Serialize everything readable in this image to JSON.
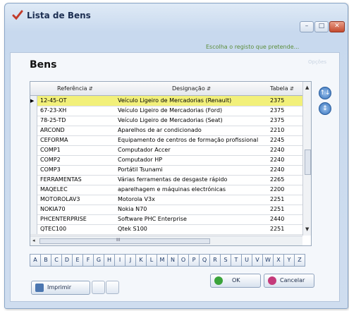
{
  "window": {
    "title": "Lista de Bens"
  },
  "controls": {
    "minimize": "–",
    "maximize": "□",
    "close": "✕"
  },
  "hint": "Escolha o registo que pretende...",
  "hint_right": "Opções",
  "heading": "Bens",
  "table": {
    "columns": [
      "Referência",
      "Designação",
      "Tabela"
    ],
    "sort_glyph": "⇵",
    "rows": [
      {
        "ref": "12-45-OT",
        "desc": "Veículo Ligeiro de Mercadorias (Renault)",
        "tab": "2375"
      },
      {
        "ref": "67-23-XH",
        "desc": "Veículo Ligeiro de Mercadorias (Ford)",
        "tab": "2375"
      },
      {
        "ref": "78-25-TD",
        "desc": "Veículo Ligeiro de Mercadorias (Seat)",
        "tab": "2375"
      },
      {
        "ref": "ARCOND",
        "desc": "Aparelhos de ar condicionado",
        "tab": "2210"
      },
      {
        "ref": "CEFORMA",
        "desc": "Equipamento de centros de formação profissional",
        "tab": "2245"
      },
      {
        "ref": "COMP1",
        "desc": "Computador Accer",
        "tab": "2240"
      },
      {
        "ref": "COMP2",
        "desc": "Computador HP",
        "tab": "2240"
      },
      {
        "ref": "COMP3",
        "desc": "Portátil Tsunami",
        "tab": "2240"
      },
      {
        "ref": "FERRAMENTAS",
        "desc": "Várias ferramentas de desgaste rápido",
        "tab": "2265"
      },
      {
        "ref": "MAQELEC",
        "desc": "aparelhagem e máquinas electrónicas",
        "tab": "2200"
      },
      {
        "ref": "MOTOROLAV3",
        "desc": "Motorola V3x",
        "tab": "2251"
      },
      {
        "ref": "NOKIA70",
        "desc": "Nokia N70",
        "tab": "2251"
      },
      {
        "ref": "PHCENTERPRISE",
        "desc": "Software PHC Enterprise",
        "tab": "2440"
      },
      {
        "ref": "QTEC100",
        "desc": "Qtek S100",
        "tab": "2251"
      }
    ],
    "selected_index": 0,
    "current_row_marker": "▶"
  },
  "scroll": {
    "up": "▲",
    "down": "▼",
    "left": "◂",
    "grip": "III"
  },
  "side_buttons": [
    "↑↓",
    "↕"
  ],
  "letters": [
    "A",
    "B",
    "C",
    "D",
    "E",
    "F",
    "G",
    "H",
    "I",
    "J",
    "K",
    "L",
    "M",
    "N",
    "O",
    "P",
    "Q",
    "R",
    "S",
    "T",
    "U",
    "V",
    "W",
    "X",
    "Y",
    "Z"
  ],
  "buttons": {
    "print": "Imprimir",
    "ok": "OK",
    "cancel": "Cancelar"
  },
  "colors": {
    "selection": "#f2f07a",
    "ok_icon": "#3aa33a",
    "cancel_icon": "#c43a7a",
    "print_icon": "#4b76b0"
  }
}
